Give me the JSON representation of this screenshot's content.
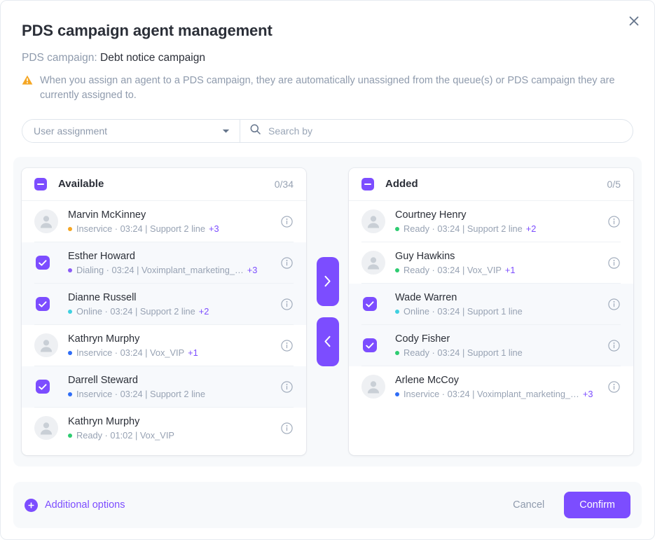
{
  "dialog": {
    "title": "PDS campaign agent management",
    "subtitle_label": "PDS campaign:",
    "campaign_name": "Debt notice campaign",
    "notice": "When you assign an agent to a PDS campaign, they are automatically unassigned from the queue(s) or PDS campaign they are currently assigned to.",
    "close_icon": "close-icon"
  },
  "filters": {
    "select_value": "User assignment",
    "search_placeholder": "Search by",
    "search_value": "",
    "search_icon": "search-icon",
    "caret_icon": "chevron-down-icon"
  },
  "transfer": {
    "move_right_icon": "chevron-right-icon",
    "move_left_icon": "chevron-left-icon"
  },
  "colors": {
    "accent": "#7C4DFF",
    "status_ready": "#2ECC71",
    "status_online": "#3FD0E0",
    "status_dialing": "#8B5CF6",
    "status_inservice_blue": "#2F6DF6",
    "status_inservice_amber": "#F5A623",
    "muted": "#97A2B3"
  },
  "panels": [
    {
      "id": "available",
      "title": "Available",
      "count": "0/34",
      "header_checkbox_state": "indeterminate",
      "rows": [
        {
          "name": "Marvin McKinney",
          "status": "Inservice",
          "status_color": "#F5A623",
          "meta": "Inservice · 03:24 | Support 2 line",
          "more": "+3",
          "selected": false
        },
        {
          "name": "Esther Howard",
          "status": "Dialing",
          "status_color": "#8B5CF6",
          "meta": "Dialing · 03:24 | Voximplant_marketing_…",
          "more": "+3",
          "selected": true
        },
        {
          "name": "Dianne Russell",
          "status": "Online",
          "status_color": "#3FD0E0",
          "meta": "Online · 03:24 | Support 2 line",
          "more": "+2",
          "selected": true
        },
        {
          "name": "Kathryn Murphy",
          "status": "Inservice",
          "status_color": "#2F6DF6",
          "meta": "Inservice · 03:24 | Vox_VIP",
          "more": "+1",
          "selected": false
        },
        {
          "name": "Darrell Steward",
          "status": "Inservice",
          "status_color": "#2F6DF6",
          "meta": "Inservice · 03:24 | Support 2 line",
          "more": "",
          "selected": true
        },
        {
          "name": "Kathryn Murphy",
          "status": "Ready",
          "status_color": "#2ECC71",
          "meta": "Ready · 01:02 | Vox_VIP",
          "more": "",
          "selected": false
        }
      ]
    },
    {
      "id": "added",
      "title": "Added",
      "count": "0/5",
      "header_checkbox_state": "indeterminate",
      "rows": [
        {
          "name": "Courtney Henry",
          "status": "Ready",
          "status_color": "#2ECC71",
          "meta": "Ready · 03:24 | Support 2 line",
          "more": "+2",
          "selected": false
        },
        {
          "name": "Guy Hawkins",
          "status": "Ready",
          "status_color": "#2ECC71",
          "meta": "Ready · 03:24 | Vox_VIP",
          "more": "+1",
          "selected": false
        },
        {
          "name": "Wade Warren",
          "status": "Online",
          "status_color": "#3FD0E0",
          "meta": "Online · 03:24 | Support 1 line",
          "more": "",
          "selected": true
        },
        {
          "name": "Cody Fisher",
          "status": "Ready",
          "status_color": "#2ECC71",
          "meta": "Ready · 03:24 | Support 1 line",
          "more": "",
          "selected": true
        },
        {
          "name": "Arlene McCoy",
          "status": "Inservice",
          "status_color": "#2F6DF6",
          "meta": "Inservice · 03:24 | Voximplant_marketing_…",
          "more": "+3",
          "selected": false
        }
      ]
    }
  ],
  "footer": {
    "additional_options": "Additional options",
    "cancel": "Cancel",
    "confirm": "Confirm",
    "plus_icon": "plus-circle-icon"
  }
}
